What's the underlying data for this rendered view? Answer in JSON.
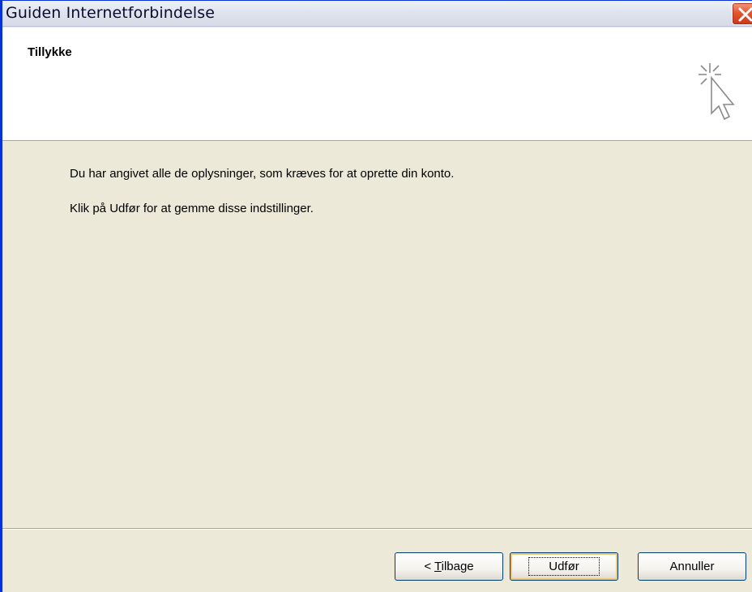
{
  "window": {
    "title": "Guiden Internetforbindelse"
  },
  "header": {
    "title": "Tillykke",
    "icon": "wizard-cursor-sparkle-icon"
  },
  "content": {
    "line1": "Du har angivet alle de oplysninger, som kræves for at oprette din konto.",
    "line2": "Klik på Udfør for at gemme disse indstillinger."
  },
  "buttons": {
    "back_prefix": "< ",
    "back_mnemonic": "T",
    "back_rest": "ilbage",
    "finish": "Udfør",
    "cancel": "Annuller"
  },
  "colors": {
    "dialog_bg": "#ece9d8",
    "close_button": "#e2572f",
    "button_border": "#003c74",
    "focus_highlight": "#f0c674"
  }
}
